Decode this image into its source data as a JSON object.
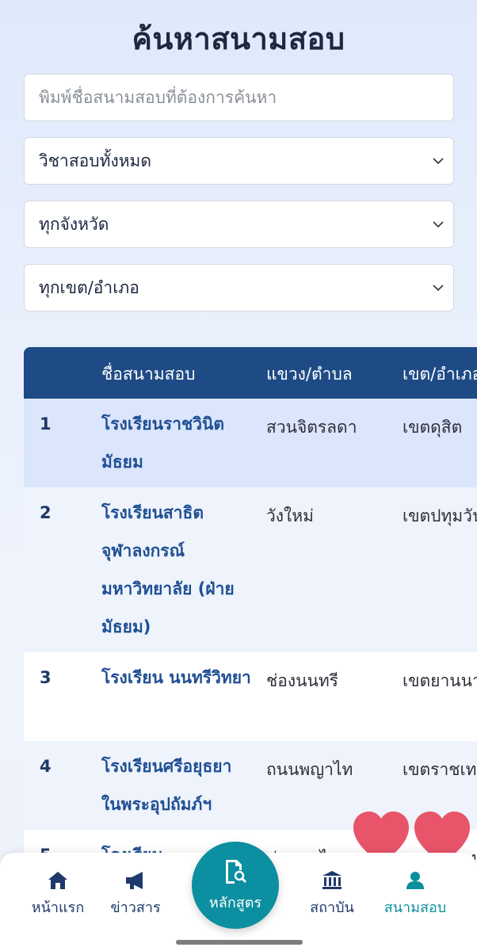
{
  "page": {
    "title": "ค้นหาสนามสอบ"
  },
  "search": {
    "placeholder": "พิมพ์ชื่อสนามสอบที่ต้องการค้นหา"
  },
  "filters": {
    "subject": "วิชาสอบทั้งหมด",
    "province": "ทุกจังหวัด",
    "district": "ทุกเขต/อำเภอ"
  },
  "table": {
    "headers": [
      "ชื่อสนามสอบ",
      "แขวง/ตำบล",
      "เขต/อำเภอ"
    ],
    "rows": [
      {
        "no": "1",
        "name": "โรงเรียนราชวินิต มัธยม",
        "subdistrict": "สวนจิตรลดา",
        "district": "เขตดุสิต"
      },
      {
        "no": "2",
        "name": "โรงเรียนสาธิต จุฬาลงกรณ์ มหาวิทยาลัย (ฝ่าย มัธยม)",
        "subdistrict": "วังใหม่",
        "district": "เขตปทุมวัน"
      },
      {
        "no": "3",
        "name": "โรงเรียน นนทรีวิทยา",
        "subdistrict": "ช่องนนทรี",
        "district": "เขตยานนาว"
      },
      {
        "no": "4",
        "name": "โรงเรียนศรีอยุธยา ในพระอุปถัมภ์ฯ",
        "subdistrict": "ถนนพญาไท",
        "district": "เขตราชเทวี"
      },
      {
        "no": "5",
        "name": "โรงเรียน",
        "subdistrict": "ทุ่งพญาไท",
        "district": "เขตราชเทวี"
      }
    ]
  },
  "nav": {
    "home": "หน้าแรก",
    "news": "ข่าวสาร",
    "courses": "หลักสูตร",
    "institutions": "สถาบัน",
    "exam_sites": "สนามสอบ"
  },
  "colors": {
    "header": "#1e4b86",
    "accent": "#0c8fa0",
    "highlight_row": "#dbe5fb"
  },
  "icons": [
    "chevron-down-icon",
    "home-icon",
    "megaphone-icon",
    "document-search-icon",
    "bank-icon",
    "person-icon",
    "heart-icon"
  ]
}
